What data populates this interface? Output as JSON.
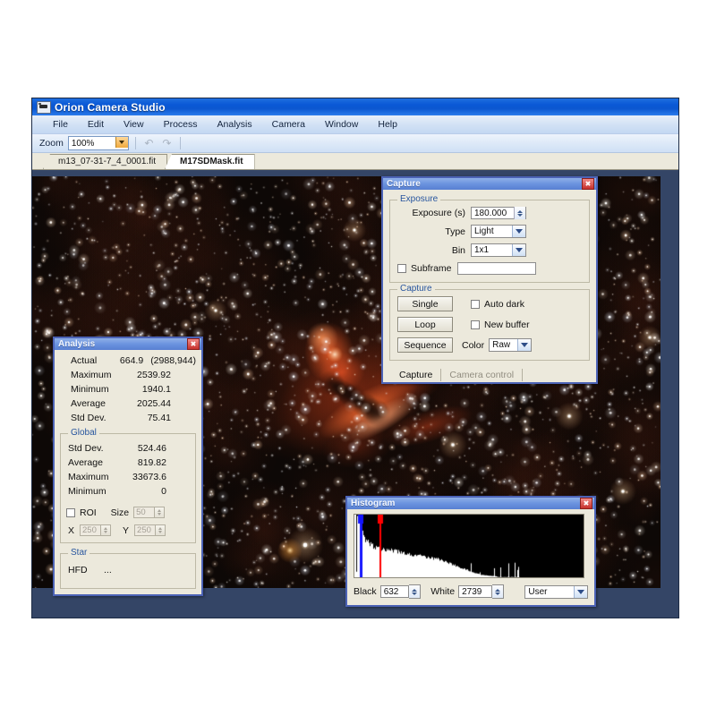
{
  "window": {
    "title": "Orion Camera Studio",
    "icon": "camera-icon",
    "menu": [
      "File",
      "Edit",
      "View",
      "Process",
      "Analysis",
      "Camera",
      "Window",
      "Help"
    ],
    "toolbar": {
      "zoom_label": "Zoom",
      "zoom_value": "100%",
      "undo_icon": "undo-arrow-icon",
      "redo_icon": "redo-arrow-icon"
    },
    "tabs": [
      {
        "label": "m13_07-31-7_4_0001.fit",
        "active": false
      },
      {
        "label": "M17SDMask.fit",
        "active": true
      }
    ]
  },
  "capture": {
    "title": "Capture",
    "close_icon": "close-icon",
    "exposure_group": "Exposure",
    "exposure_label": "Exposure (s)",
    "exposure_value": "180.000",
    "type_label": "Type",
    "type_value": "Light",
    "bin_label": "Bin",
    "bin_value": "1x1",
    "subframe_label": "Subframe",
    "subframe_checked": false,
    "subframe_value": "",
    "capture_group": "Capture",
    "single_label": "Single",
    "loop_label": "Loop",
    "sequence_label": "Sequence",
    "auto_dark_label": "Auto dark",
    "auto_dark_checked": false,
    "new_buffer_label": "New buffer",
    "new_buffer_checked": false,
    "color_label": "Color",
    "color_value": "Raw",
    "tabs": [
      {
        "label": "Capture",
        "active": true
      },
      {
        "label": "Camera control",
        "active": false
      }
    ]
  },
  "analysis": {
    "title": "Analysis",
    "close_icon": "close-icon",
    "rows": [
      {
        "key": "Actual",
        "value": "664.9",
        "extra": "(2988,944)"
      },
      {
        "key": "Maximum",
        "value": "2539.92",
        "extra": ""
      },
      {
        "key": "Minimum",
        "value": "1940.1",
        "extra": ""
      },
      {
        "key": "Average",
        "value": "2025.44",
        "extra": ""
      },
      {
        "key": "Std Dev.",
        "value": "75.41",
        "extra": ""
      }
    ],
    "global_group": "Global",
    "global_rows": [
      {
        "key": "Std Dev.",
        "value": "524.46"
      },
      {
        "key": "Average",
        "value": "819.82"
      },
      {
        "key": "Maximum",
        "value": "33673.6"
      },
      {
        "key": "Minimum",
        "value": "0"
      }
    ],
    "roi_label": "ROI",
    "roi_checked": false,
    "size_label": "Size",
    "size_value": "50",
    "x_label": "X",
    "x_value": "250",
    "y_label": "Y",
    "y_value": "250",
    "star_group": "Star",
    "hfd_label": "HFD",
    "hfd_value": "..."
  },
  "histogram": {
    "title": "Histogram",
    "close_icon": "close-icon",
    "black_label": "Black",
    "black_value": "632",
    "white_label": "White",
    "white_value": "2739",
    "mode_value": "User",
    "marker_black_color": "#1414ff",
    "marker_white_color": "#ff0000"
  },
  "image": {
    "name": "m17-swan-nebula-astrophoto",
    "background_color": "#0d0806",
    "nebula_color": "#e8411a"
  },
  "colors": {
    "titlebar_blue": "#0b57d0",
    "palette_border": "#4c63b6",
    "palette_face": "#ece9dc",
    "desktop": "#344566",
    "group_legend": "#27559e"
  }
}
